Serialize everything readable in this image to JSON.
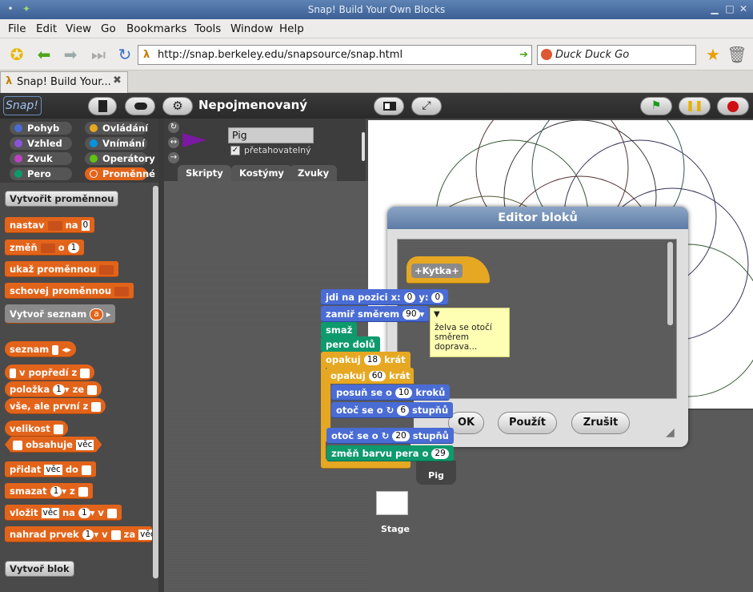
{
  "window": {
    "title": "Snap! Build Your Own Blocks"
  },
  "menu": [
    "File",
    "Edit",
    "View",
    "Go",
    "Bookmarks",
    "Tools",
    "Window",
    "Help"
  ],
  "nav": {
    "url": "http://snap.berkeley.edu/snapsource/snap.html",
    "search_placeholder": "Duck Duck Go"
  },
  "tab": {
    "label": "Snap! Build Your..."
  },
  "snap": {
    "logo": "Snap!",
    "project_name": "Nepojmenovaný",
    "categories": [
      "Pohyb",
      "Ovládání",
      "Vzhled",
      "Vnímání",
      "Zvuk",
      "Operátory",
      "Pero",
      "Proměnné"
    ],
    "category_colors": [
      "#4a6cd4",
      "#e6a822",
      "#8a55d7",
      "#0494dc",
      "#bb42c3",
      "#62c213",
      "#0e9a6c",
      "#e2641a"
    ],
    "sprite": {
      "name": "Pig",
      "draggable_label": "přetahovatelný"
    },
    "tabs": [
      "Skripty",
      "Kostýmy",
      "Zvuky"
    ],
    "palette": {
      "make_variable": "Vytvořit proměnnou",
      "set": "nastav",
      "set_to": "na",
      "set_val": "0",
      "change": "změň",
      "change_by": "o",
      "change_val": "1",
      "show_var": "ukaž proměnnou",
      "hide_var": "schovej proměnnou",
      "make_list": "Vytvoř seznam",
      "make_list_arg": "a",
      "list": "seznam",
      "in_front_of": "v popředí z",
      "item": "položka",
      "item_val": "1",
      "item_of": "ze",
      "all_but_first": "vše, ale první z",
      "length": "velikost",
      "contains": "obsahuje",
      "contains_val": "věc",
      "add": "přidat",
      "add_val": "věc",
      "add_to": "do",
      "delete": "smazat",
      "delete_val": "1",
      "delete_of": "z",
      "insert": "vložit",
      "insert_val": "věc",
      "insert_at": "na",
      "insert_pos": "1",
      "insert_of": "v",
      "replace": "nahrad prvek",
      "replace_pos": "1",
      "replace_of": "v",
      "replace_with": "za",
      "replace_val": "věc",
      "make_block": "Vytvoř blok"
    },
    "script": {
      "goto": "jdi na pozici x:",
      "goto_x": "0",
      "goto_y_label": "y:",
      "goto_y": "0",
      "point": "zamiř směrem",
      "point_val": "90",
      "clear": "smaž",
      "pen_down": "pero dolů",
      "repeat1": "opakuj",
      "repeat1_val": "18",
      "times": "krát",
      "repeat2": "opakuj",
      "repeat2_val": "60",
      "times2": "krát",
      "move": "posuň se o",
      "move_val": "10",
      "steps": "kroků",
      "turn": "otoč se o",
      "turn_val": "6",
      "degrees": "stupňů",
      "turn2": "otoč se o",
      "turn2_val": "20",
      "degrees2": "stupňů",
      "pen_color": "změň barvu pera o",
      "pen_color_val": "29"
    },
    "comment": "želva se otočí směrem doprava...",
    "dialog": {
      "title": "Editor bloků",
      "hat_label": "Kytka",
      "ok": "OK",
      "apply": "Použít",
      "cancel": "Zrušit"
    },
    "corral": {
      "sprite": "Pig",
      "stage": "Stage"
    }
  }
}
